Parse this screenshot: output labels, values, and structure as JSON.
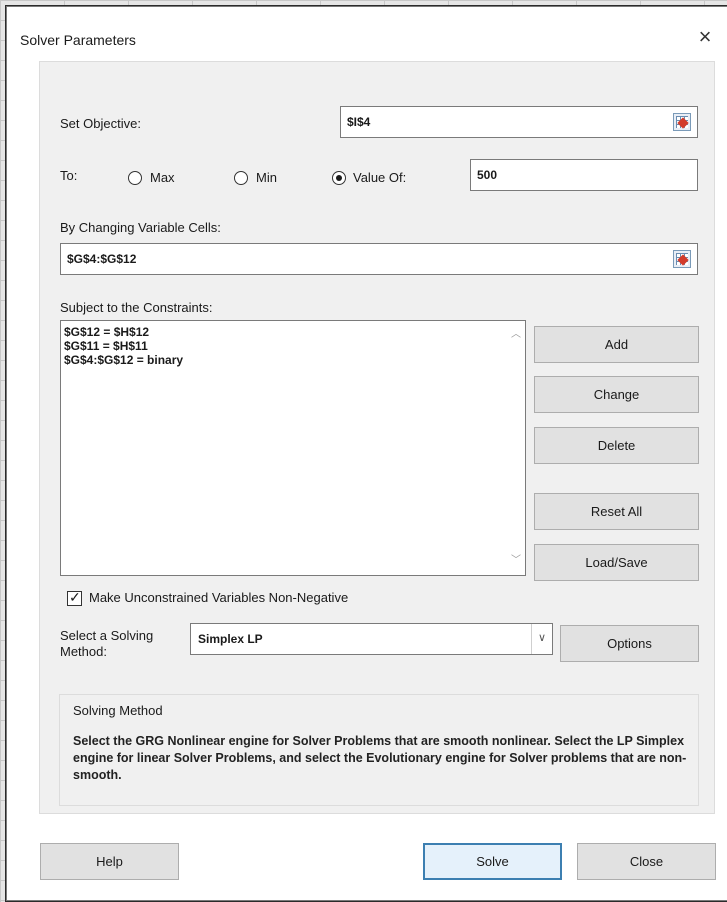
{
  "window": {
    "title": "Solver Parameters",
    "close_glyph": "×"
  },
  "objective": {
    "label": "Set Objective:",
    "value": "$I$4"
  },
  "to": {
    "label": "To:",
    "options": [
      {
        "label": "Max",
        "checked": false
      },
      {
        "label": "Min",
        "checked": false
      },
      {
        "label": "Value Of:",
        "checked": true
      }
    ],
    "value_of": "500"
  },
  "variables": {
    "label": "By Changing Variable Cells:",
    "value": "$G$4:$G$12"
  },
  "constraints": {
    "label": "Subject to the Constraints:",
    "items": [
      "$G$12 = $H$12",
      "$G$11 = $H$11",
      "$G$4:$G$12 = binary"
    ]
  },
  "constraint_buttons": {
    "add": "Add",
    "change": "Change",
    "delete": "Delete",
    "reset_all": "Reset All",
    "load_save": "Load/Save"
  },
  "nonneg": {
    "label": "Make Unconstrained Variables Non-Negative",
    "checked": true
  },
  "method": {
    "label_line1": "Select a Solving",
    "label_line2": "Method:",
    "value": "Simplex LP",
    "options_button": "Options"
  },
  "solving_method": {
    "title": "Solving Method",
    "text": "Select the GRG Nonlinear engine for Solver Problems that are smooth nonlinear. Select the LP Simplex engine for linear Solver Problems, and select the Evolutionary engine for Solver problems that are non-smooth."
  },
  "footer": {
    "help": "Help",
    "solve": "Solve",
    "close": "Close"
  },
  "icons": {
    "collapse": "range-selector-icon",
    "checkbox": "checkmark-icon",
    "dropdown": "chevron-down-icon"
  },
  "colors": {
    "default_button_border": "#3c7fb1",
    "panel_bg": "#f0f0f0"
  }
}
